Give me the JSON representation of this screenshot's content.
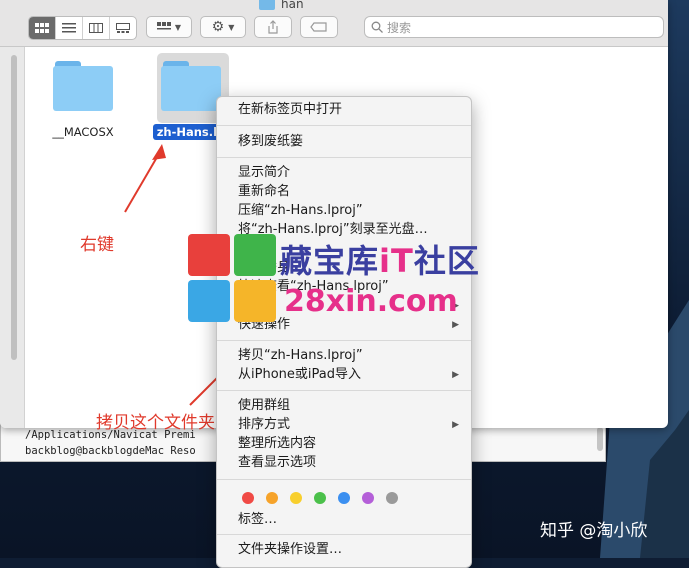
{
  "window": {
    "title": "han",
    "search_placeholder": "搜索"
  },
  "files": [
    {
      "name": "__MACOSX",
      "selected": false
    },
    {
      "name": "zh-Hans.lp",
      "selected": true
    }
  ],
  "terminal": {
    "line1": "/Applications/Navicat Premi",
    "line2": "backblog@backblogdeMac Reso"
  },
  "menu": {
    "open_new_tab": "在新标签页中打开",
    "move_trash": "移到废纸篓",
    "get_info": "显示简介",
    "rename": "重新命名",
    "compress": "压缩“zh-Hans.lproj”",
    "burn": "将“zh-Hans.lproj”刻录至光盘…",
    "duplicate": "复制",
    "make_alias": "制作替身",
    "quick_look": "快速查看“zh-Hans.lproj”",
    "share": "共享",
    "quick_actions": "快速操作",
    "copy": "拷贝“zh-Hans.lproj”",
    "import_iphone": "从iPhone或iPad导入",
    "use_groups": "使用群组",
    "sort_by": "排序方式",
    "clean_up": "整理所选内容",
    "view_options": "查看显示选项",
    "tags": "标签…",
    "folder_actions": "文件夹操作设置…"
  },
  "tag_colors": [
    "#f04a45",
    "#f6a32a",
    "#f8cf2d",
    "#4bc04a",
    "#3b8ff0",
    "#b45fd8",
    "#9a9a9a"
  ],
  "annotations": {
    "right_click": "右键",
    "copy_folder": "拷贝这个文件夹"
  },
  "watermark": {
    "cn": "藏宝库iT社区",
    "cn_colors": [
      "#3a3fa0",
      "#3a3fa0",
      "#3a3fa0",
      "#e6308a",
      "#3a3fa0",
      "#3a3fa0"
    ],
    "url": "28xin.com",
    "logo_colors": [
      "#e8403c",
      "#3fb44a",
      "#3aa7e5",
      "#f5b529"
    ]
  },
  "credit": "知乎 @淘小欣"
}
